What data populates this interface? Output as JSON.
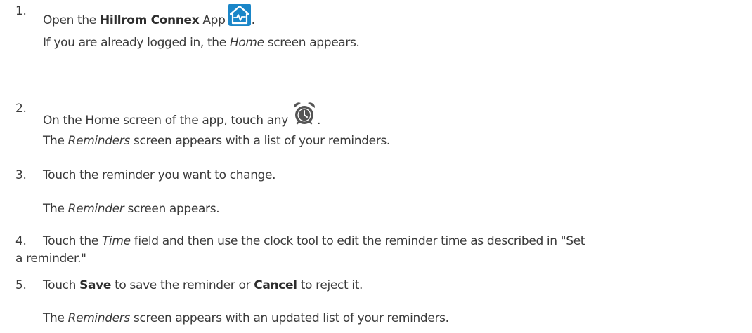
{
  "steps": [
    {
      "number": "1.",
      "text_before": "Open the ",
      "bold1": "Hillrom Connex",
      "text_after": " App",
      "icon": "home-app-icon",
      "end": ".",
      "note_before": "If you are already logged in, the ",
      "note_italic": "Home",
      "note_after": " screen appears."
    },
    {
      "number": "2.",
      "text_before": "On the Home screen of the app, touch any ",
      "icon": "alarm-clock-icon",
      "end": ".",
      "note_before": "The ",
      "note_italic": "Reminders",
      "note_after": " screen appears with a list of your reminders."
    },
    {
      "number": "3.",
      "text": "Touch the reminder you want to change.",
      "note_before": "The ",
      "note_italic": "Reminder",
      "note_after": " screen appears."
    },
    {
      "number": "4.",
      "text_before": "Touch the ",
      "italic": "Time",
      "text_after": " field and then use the clock tool to edit the reminder time as described in \"Set",
      "continuation": "a reminder.\""
    },
    {
      "number": "5.",
      "text_before": "Touch ",
      "bold1": "Save",
      "text_mid": " to save the reminder or ",
      "bold2": "Cancel",
      "text_after": " to reject it.",
      "note_before": "The ",
      "note_italic": "Reminders",
      "note_after": " screen appears with an updated list of your reminders."
    }
  ],
  "colors": {
    "text": "#3a3a3a",
    "home_icon_bg": "#1a86c8",
    "clock_icon": "#555555"
  }
}
